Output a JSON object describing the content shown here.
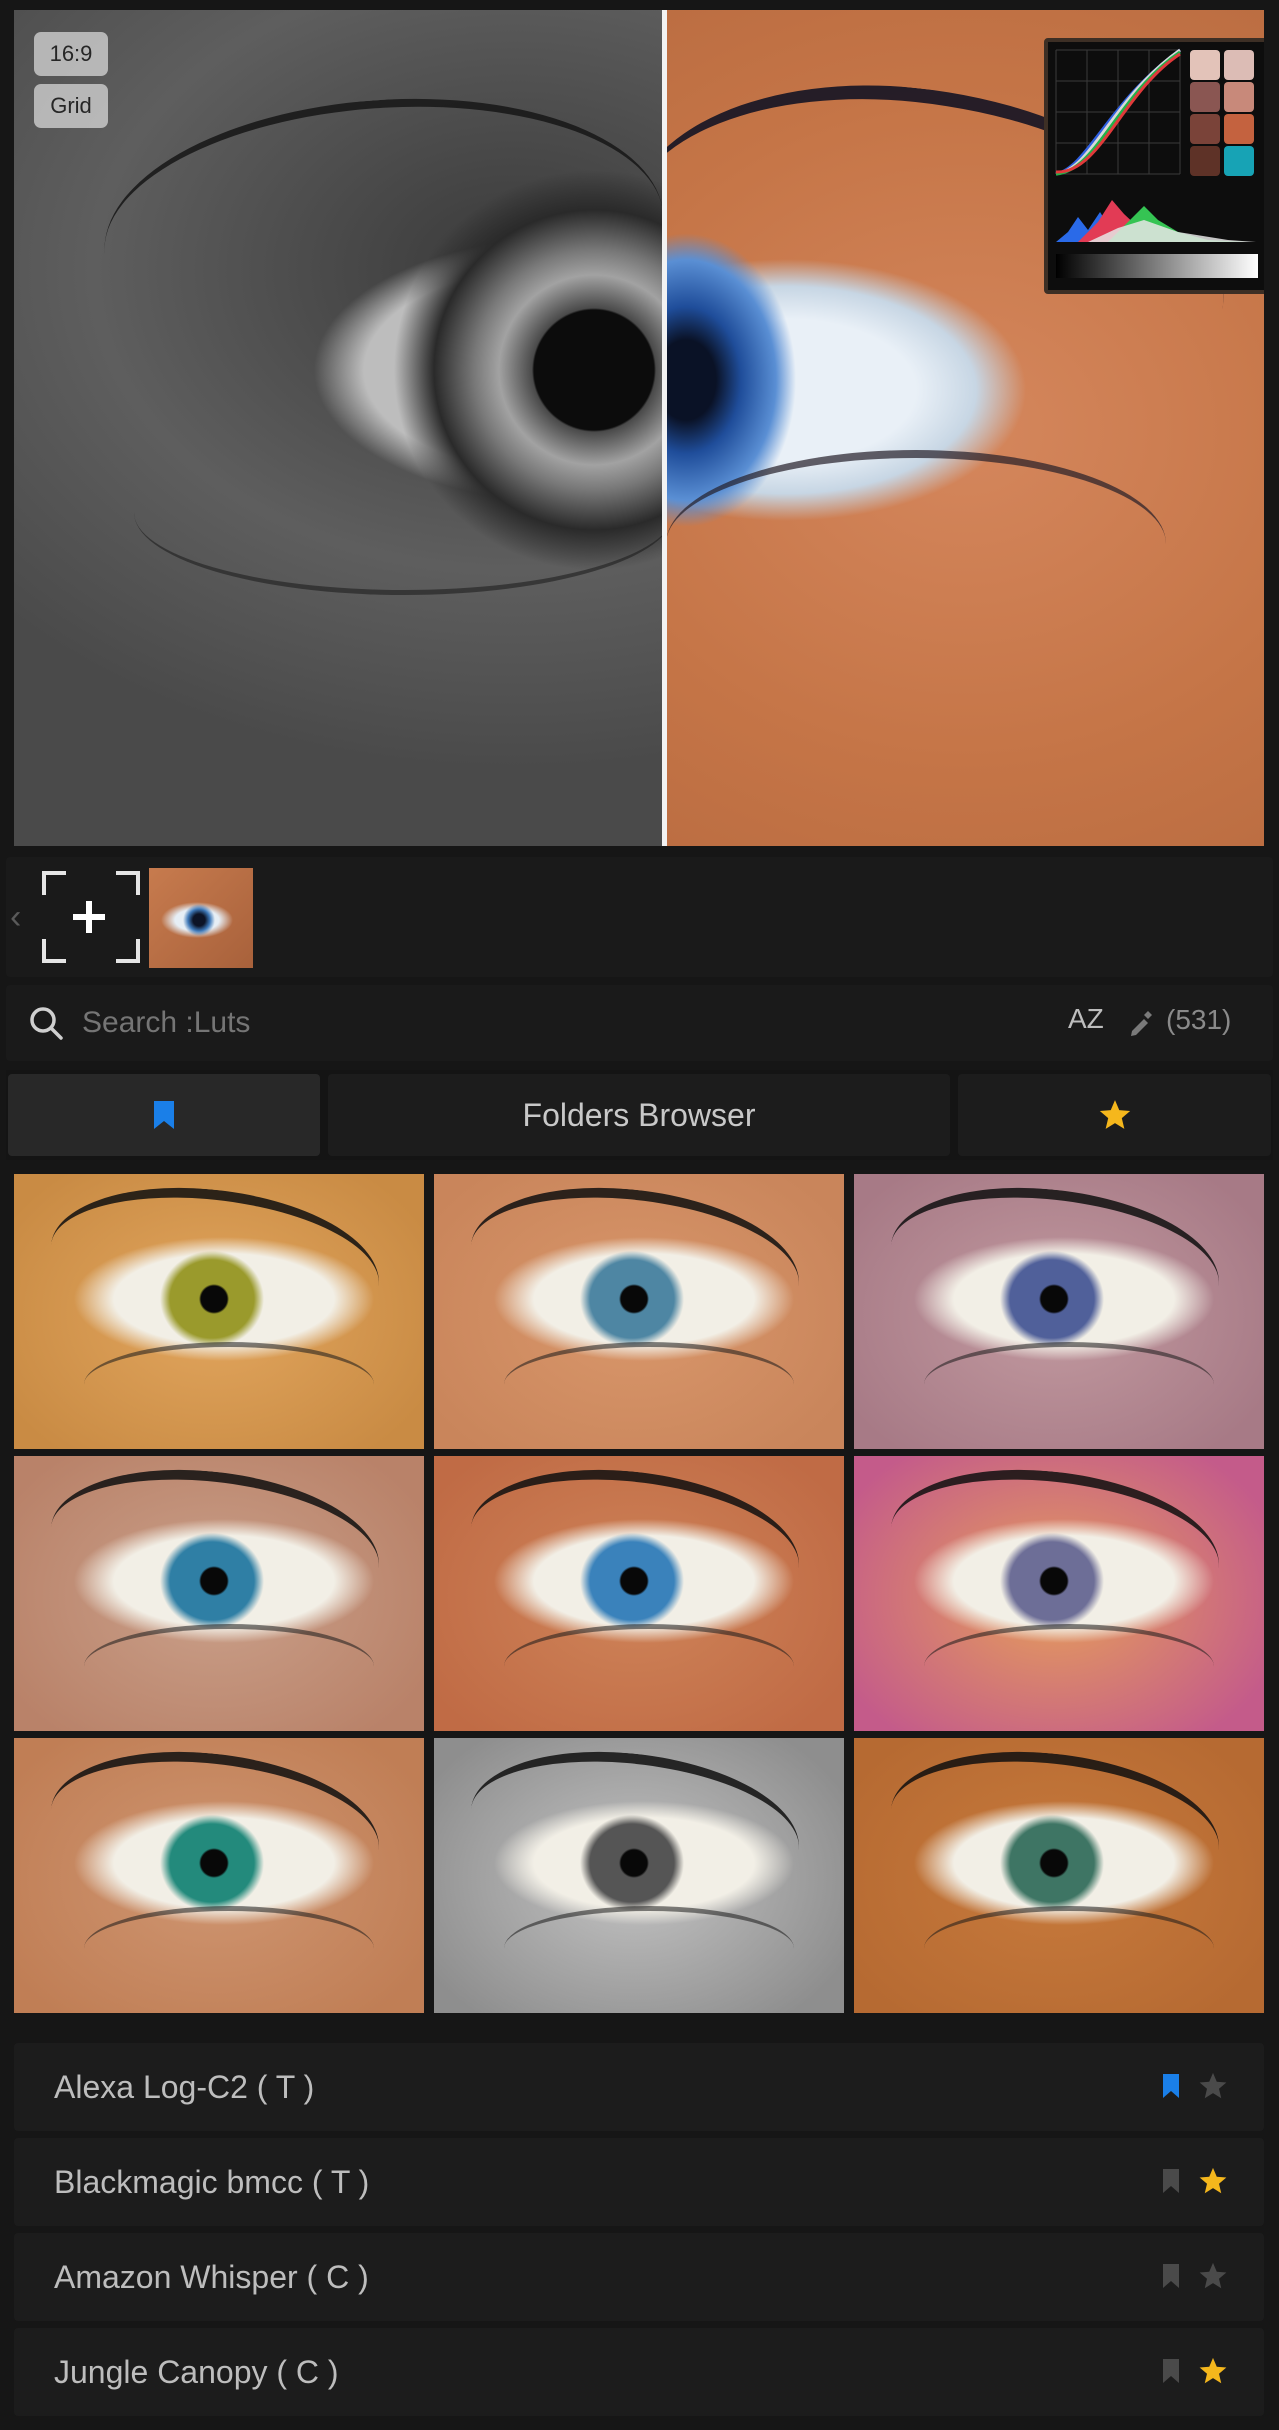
{
  "preview": {
    "aspect_label": "16:9",
    "grid_label": "Grid"
  },
  "scopes": {
    "swatches": [
      "#e3c3b9",
      "#dcbcb5",
      "#8a5652",
      "#c8897a",
      "#7a4339",
      "#c4623f",
      "#5e3227",
      "#17a3b5"
    ]
  },
  "thumb_bar": {
    "add_icon": "add-frame-icon"
  },
  "search": {
    "placeholder": "Search :Luts",
    "sort_label": "AZ",
    "count": "(531)"
  },
  "tabs": {
    "folders_label": "Folders Browser",
    "bookmark_color": "#1a7fe8",
    "star_color": "#f5b71c"
  },
  "grid": {
    "cells": [
      {
        "bg": "#c98b44",
        "iris": "#9a9a2c",
        "tone": "#e2a65e"
      },
      {
        "bg": "#c9855b",
        "iris": "#4e86a3",
        "tone": "#d9976b"
      },
      {
        "bg": "#a77a86",
        "iris": "#50609a",
        "tone": "#c29aa0"
      },
      {
        "bg": "#b98269",
        "iris": "#2f7fa5",
        "tone": "#caa08a"
      },
      {
        "bg": "#c06b45",
        "iris": "#3a82bb",
        "tone": "#cf8459"
      },
      {
        "bg": "#c45b8a",
        "iris": "#6d6e97",
        "tone": "#e6a05a"
      },
      {
        "bg": "#c07e55",
        "iris": "#238a7c",
        "tone": "#cf9672"
      },
      {
        "bg": "#8e8e8e",
        "iris": "#555555",
        "tone": "#c4c4c4"
      },
      {
        "bg": "#b66a32",
        "iris": "#3e7564",
        "tone": "#c77a3c"
      }
    ]
  },
  "list": {
    "items": [
      {
        "label": "Alexa Log-C2 ( T )",
        "bookmarked": true,
        "starred": false
      },
      {
        "label": "Blackmagic bmcc ( T )",
        "bookmarked": false,
        "starred": true
      },
      {
        "label": "Amazon Whisper ( C )",
        "bookmarked": false,
        "starred": false
      },
      {
        "label": "Jungle Canopy ( C )",
        "bookmarked": false,
        "starred": true
      }
    ]
  }
}
